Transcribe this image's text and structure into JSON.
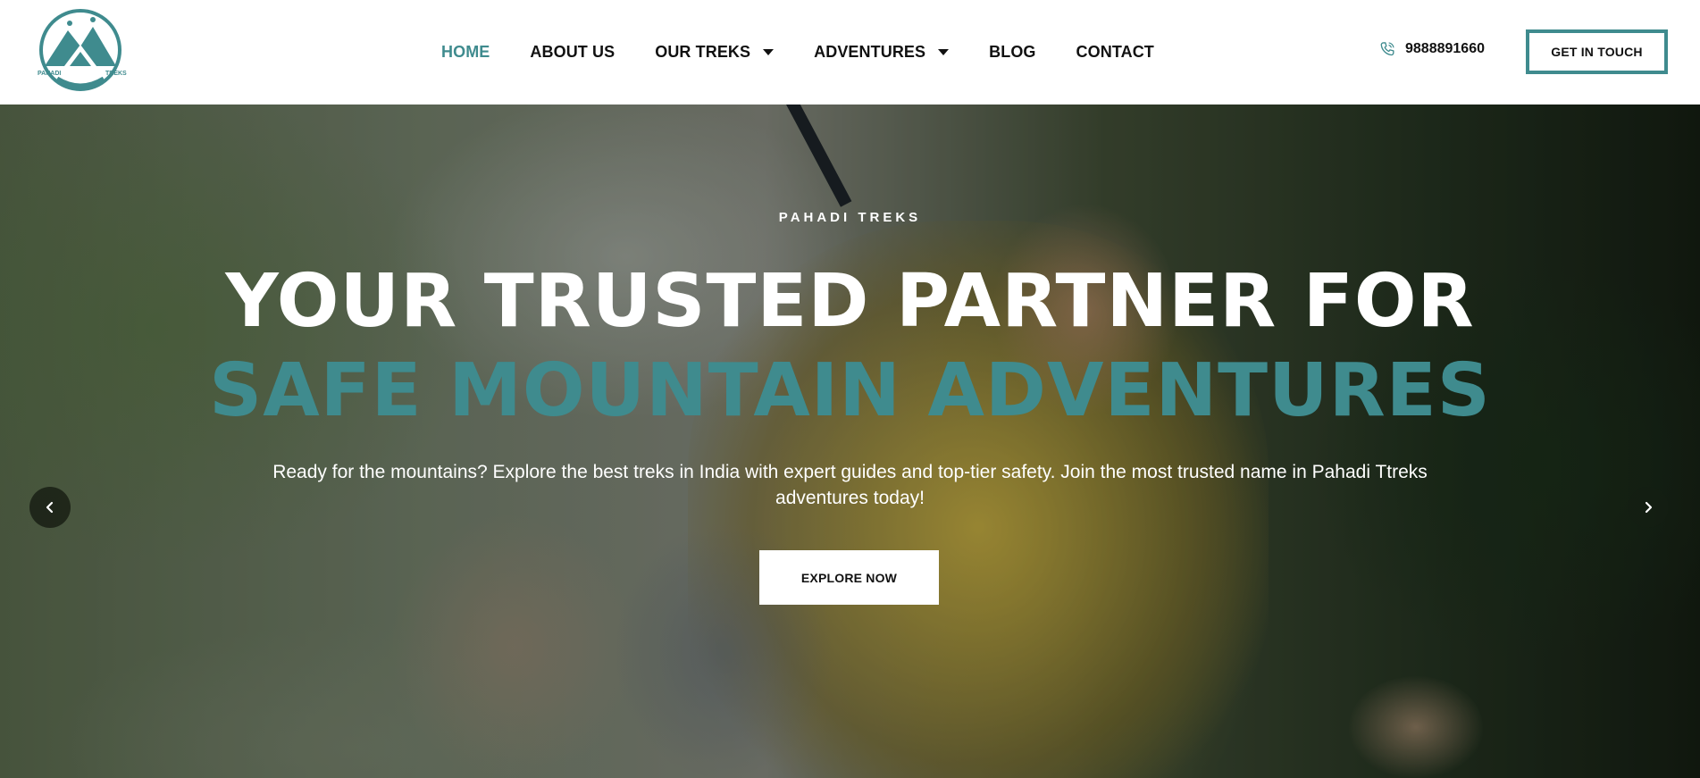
{
  "brand": {
    "name": "Pahadi Treks",
    "logo_text_left": "PAHADI",
    "logo_text_right": "TREKS",
    "logo_icon": "mountain-hikers-logo",
    "accent_color": "#3f8b8e"
  },
  "nav": {
    "items": [
      {
        "label": "HOME",
        "active": true,
        "has_dropdown": false
      },
      {
        "label": "ABOUT US",
        "active": false,
        "has_dropdown": false
      },
      {
        "label": "OUR TREKS",
        "active": false,
        "has_dropdown": true
      },
      {
        "label": "ADVENTURES",
        "active": false,
        "has_dropdown": true
      },
      {
        "label": "BLOG",
        "active": false,
        "has_dropdown": false
      },
      {
        "label": "CONTACT",
        "active": false,
        "has_dropdown": false
      }
    ],
    "phone": "9888891660",
    "phone_icon": "phone-icon",
    "cta_label": "GET IN TOUCH"
  },
  "hero": {
    "eyebrow": "PAHADI TREKS",
    "headline_line1": "YOUR TRUSTED PARTNER FOR",
    "headline_line2": "SAFE MOUNTAIN ADVENTURES",
    "subtitle": "Ready for the mountains? Explore the best treks in India with expert guides and top-tier safety. Join the most trusted name in Pahadi Ttreks adventures today!",
    "button_label": "EXPLORE NOW",
    "prev_icon": "chevron-left-icon",
    "next_icon": "chevron-right-icon"
  }
}
